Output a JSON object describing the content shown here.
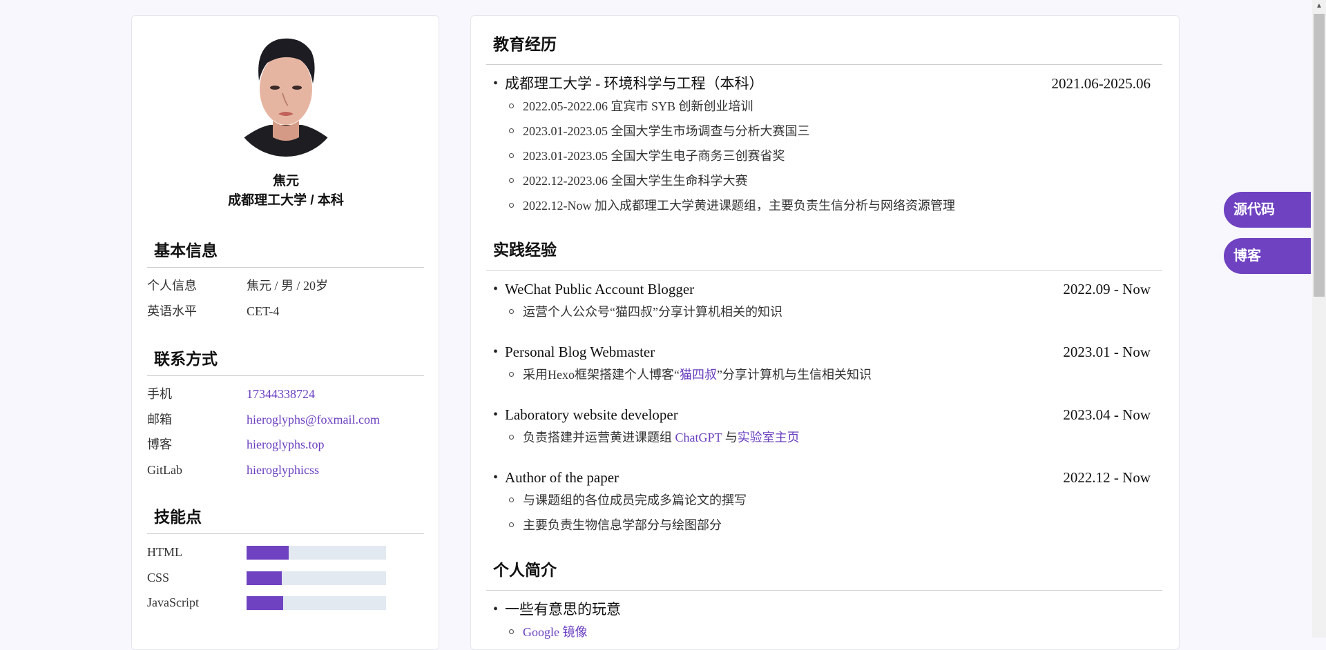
{
  "profile": {
    "name": "焦元",
    "school_degree": "成都理工大学 / 本科"
  },
  "basic_info": {
    "heading": "基本信息",
    "rows": [
      {
        "key": "个人信息",
        "value": "焦元 / 男 / 20岁"
      },
      {
        "key": "英语水平",
        "value": "CET-4"
      }
    ]
  },
  "contact": {
    "heading": "联系方式",
    "rows": [
      {
        "key": "手机",
        "value": "17344338724"
      },
      {
        "key": "邮箱",
        "value": "hieroglyphs@foxmail.com"
      },
      {
        "key": "博客",
        "value": "hieroglyphs.top"
      },
      {
        "key": "GitLab",
        "value": "hieroglyphicss"
      }
    ]
  },
  "skills": {
    "heading": "技能点",
    "items": [
      {
        "name": "HTML",
        "level": 0.3
      },
      {
        "name": "CSS",
        "level": 0.25
      },
      {
        "name": "JavaScript",
        "level": 0.26
      }
    ]
  },
  "education": {
    "heading": "教育经历",
    "items": [
      {
        "title": "成都理工大学 - 环境科学与工程（本科）",
        "date": "2021.06-2025.06",
        "subs": [
          "2022.05-2022.06 宜宾市 SYB 创新创业培训",
          "2023.01-2023.05 全国大学生市场调查与分析大赛国三",
          "2023.01-2023.05 全国大学生电子商务三创赛省奖",
          "2022.12-2023.06 全国大学生生命科学大赛",
          "2022.12-Now 加入成都理工大学黄进课题组，主要负责生信分析与网络资源管理"
        ]
      }
    ]
  },
  "practice": {
    "heading": "实践经验",
    "items": [
      {
        "title": "WeChat Public Account Blogger",
        "date": "2022.09 - Now",
        "sub": {
          "pre": "运营个人公众号“猫四叔”分享计算机相关的知识"
        }
      },
      {
        "title": "Personal Blog Webmaster",
        "date": "2023.01 - Now",
        "sub": {
          "pre": "采用Hexo框架搭建个人博客“",
          "link": "猫四叔",
          "post": "”分享计算机与生信相关知识"
        }
      },
      {
        "title": "Laboratory website developer",
        "date": "2023.04 - Now",
        "sub": {
          "pre": "负责搭建并运营黄进课题组 ",
          "link": "ChatGPT",
          "mid": " 与",
          "link2": "实验室主页"
        }
      },
      {
        "title": "Author of the paper",
        "date": "2022.12 - Now",
        "subs": [
          "与课题组的各位成员完成多篇论文的撰写",
          "主要负责生物信息学部分与绘图部分"
        ]
      }
    ]
  },
  "intro": {
    "heading": "个人简介",
    "items": [
      {
        "title": "一些有意思的玩意",
        "sub_link": "Google 镜像"
      }
    ]
  },
  "floating": {
    "source_code": "源代码",
    "blog": "博客"
  },
  "colors": {
    "accent": "#6f42c1",
    "link": "#6a3fc0",
    "bar_bg": "#e3e9f0"
  }
}
